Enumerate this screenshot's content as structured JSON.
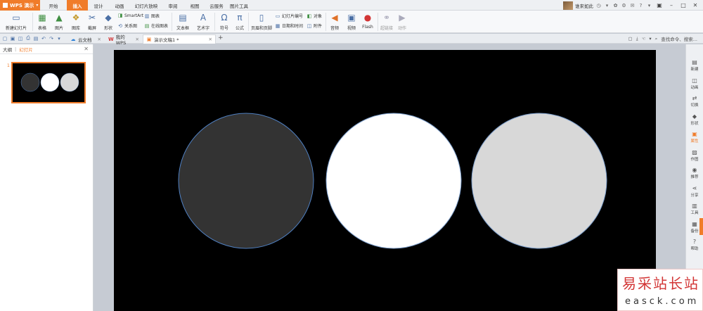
{
  "app": {
    "name": "WPS 演示"
  },
  "ribbon_tabs": [
    "开始",
    "插入",
    "设计",
    "动画",
    "幻灯片放映",
    "审阅",
    "视图",
    "云服务",
    "图片工具"
  ],
  "active_ribbon_tab": "插入",
  "user": {
    "name": "谁來如此"
  },
  "toolbar": {
    "new_slide": "新建幻灯片",
    "table": "表格",
    "picture": "图片",
    "gallery": "图库",
    "screenshot": "截屏",
    "shape": "形状",
    "smartart": "SmartArt",
    "chart": "图表",
    "relation": "关系图",
    "online_chart": "在线图表",
    "textbox": "文本框",
    "wordart": "艺术字",
    "symbol": "符号",
    "formula": "公式",
    "header_footer": "页眉和页脚",
    "slide_number": "幻灯片编号",
    "object": "对象",
    "datetime": "日期和时间",
    "attachment": "附件",
    "audio": "音频",
    "video": "视频",
    "flash": "Flash",
    "hyperlink": "超链接",
    "action": "动作"
  },
  "doc_tabs": [
    {
      "label": "云文档"
    },
    {
      "label": "我的WPS"
    },
    {
      "label": "演示文稿1 *"
    }
  ],
  "search": {
    "placeholder": "查找命令、搜索..."
  },
  "left_pane": {
    "tab_outline": "大纲",
    "tab_slides": "幻灯片",
    "slide_number": "1"
  },
  "slide": {
    "background": "#000000",
    "shapes": [
      {
        "type": "circle",
        "fill": "#333333",
        "stroke": "#4f7fc0"
      },
      {
        "type": "circle",
        "fill": "#ffffff",
        "stroke": "#7a9cc9"
      },
      {
        "type": "circle",
        "fill": "#d8d8d8",
        "stroke": "#7a9cc9"
      }
    ]
  },
  "right_sidebar": [
    "新建",
    "动画",
    "切换",
    "形状",
    "属性",
    "作图",
    "推荐",
    "分享",
    "工具",
    "备份",
    "帮助"
  ],
  "right_sidebar_active": "属性",
  "watermark": {
    "title": "易采站长站",
    "domain": "easck.com"
  },
  "colors": {
    "accent": "#f07c2a"
  }
}
